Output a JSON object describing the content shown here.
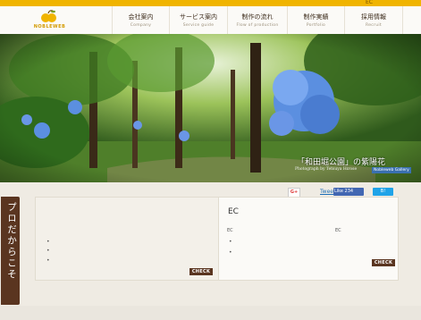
{
  "topbar": {
    "mini_label": "EC"
  },
  "logo": {
    "text": "NOBLEWEB"
  },
  "nav": [
    {
      "jp": "会社案内",
      "en": "Company"
    },
    {
      "jp": "サービス案内",
      "en": "Service guide"
    },
    {
      "jp": "制作の流れ",
      "en": "Flow of production"
    },
    {
      "jp": "制作実績",
      "en": "Portfolio"
    },
    {
      "jp": "採用情報",
      "en": "Recruit"
    }
  ],
  "hero": {
    "title": "「和田堀公園」の紫陽花",
    "photo_credit": "Photograph by Tetsuya Hirose",
    "gallery_label": "Nobleweb Gallery"
  },
  "social": {
    "gplus": "G+",
    "tweet": "Tweet",
    "like": "Like 234",
    "hatena": "B!"
  },
  "side_tab": {
    "label": "プロだからこそ"
  },
  "right_panel": {
    "title": "EC",
    "sub1": "EC",
    "sub2": "EC"
  },
  "bullets": [
    "•",
    "•",
    "•",
    "•",
    "•"
  ],
  "buttons": {
    "check_left": "CHECK",
    "check_right": "CHECK"
  },
  "colors": {
    "accent": "#f0b400",
    "brown": "#5a3520"
  }
}
